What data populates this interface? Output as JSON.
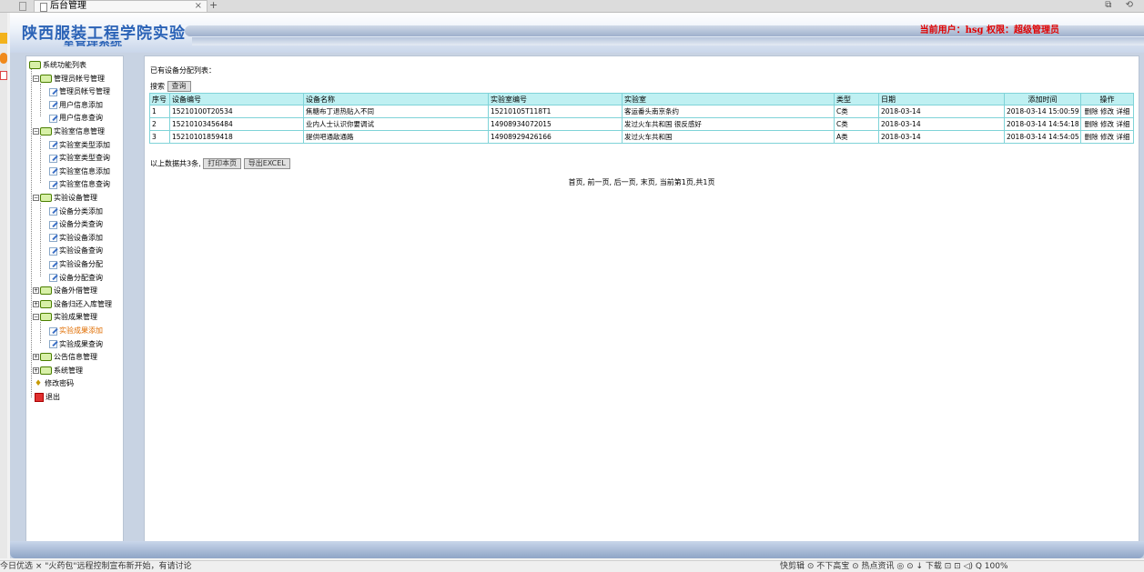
{
  "browser": {
    "tab_title": "后台管理",
    "tab_close": "×",
    "new_tab": "+",
    "window_buttons": "⧉ ⟲",
    "status_left": "今日优选    ×  \"火药包\"远程控制宣布新开始，有请讨论",
    "status_right": "快剪辑  ⊙ 不下高宝  ⊙ 热点资讯  ◎  ⊙  ↓ 下载  ⊡  ⊡  ◁)  Q 100%"
  },
  "header": {
    "site_title": "陕西服装工程学院实验",
    "site_subtitle": "室管理系统",
    "user_info": "当前用户：hsg   权限：超级管理员"
  },
  "sidebar": {
    "root": "系统功能列表",
    "groups": [
      {
        "label": "管理员帐号管理",
        "items": [
          "管理员帐号管理",
          "用户信息添加",
          "用户信息查询"
        ]
      },
      {
        "label": "实验室信息管理",
        "items": [
          "实验室类型添加",
          "实验室类型查询",
          "实验室信息添加",
          "实验室信息查询"
        ]
      },
      {
        "label": "实验设备管理",
        "items": [
          "设备分类添加",
          "设备分类查询",
          "实验设备添加",
          "实验设备查询",
          "实验设备分配",
          "设备分配查询"
        ]
      },
      {
        "label": "设备外借管理",
        "items": []
      },
      {
        "label": "设备归还入库管理",
        "items": []
      },
      {
        "label": "实验成果管理",
        "items": [
          "实验成果添加",
          "实验成果查询"
        ]
      },
      {
        "label": "公告信息管理",
        "items": []
      },
      {
        "label": "系统管理",
        "items": []
      }
    ],
    "change_password": "修改密码",
    "logout": "退出",
    "active_item": "实验成果添加"
  },
  "main": {
    "list_title": "已有设备分配列表：",
    "search_label": "搜索",
    "search_button": "查询",
    "columns": [
      "序号",
      "设备编号",
      "设备名称",
      "实验室编号",
      "实验室",
      "类型",
      "日期",
      "添加时间",
      "操作"
    ],
    "rows": [
      {
        "idx": "1",
        "code": "15210100T20534",
        "name": "焦糖布丁退热贴入不同",
        "lab_code": "15210105T118T1",
        "lab": "客运番头南京条约",
        "type": "C类",
        "date": "2018-03-14",
        "added": "2018-03-14 15:00:59",
        "ops": "删除 修改 详细"
      },
      {
        "idx": "2",
        "code": "15210103456484",
        "name": "业内人士认识你要调试",
        "lab_code": "14908934072015",
        "lab": "发过火车共和国 很反感好",
        "type": "C类",
        "date": "2018-03-14",
        "added": "2018-03-14 14:54:18",
        "ops": "删除 修改 详细"
      },
      {
        "idx": "3",
        "code": "15210101859418",
        "name": "提供吧通敌通路",
        "lab_code": "14908929426166",
        "lab": "发过火车共和国",
        "type": "A类",
        "date": "2018-03-14",
        "added": "2018-03-14 14:54:05",
        "ops": "删除 修改 详细"
      }
    ],
    "total_text": "以上数据共3条,",
    "print_button": "打印本页",
    "export_button": "导出EXCEL",
    "pager": "首页, 前一页, 后一页, 末页, 当前第1页,共1页"
  }
}
